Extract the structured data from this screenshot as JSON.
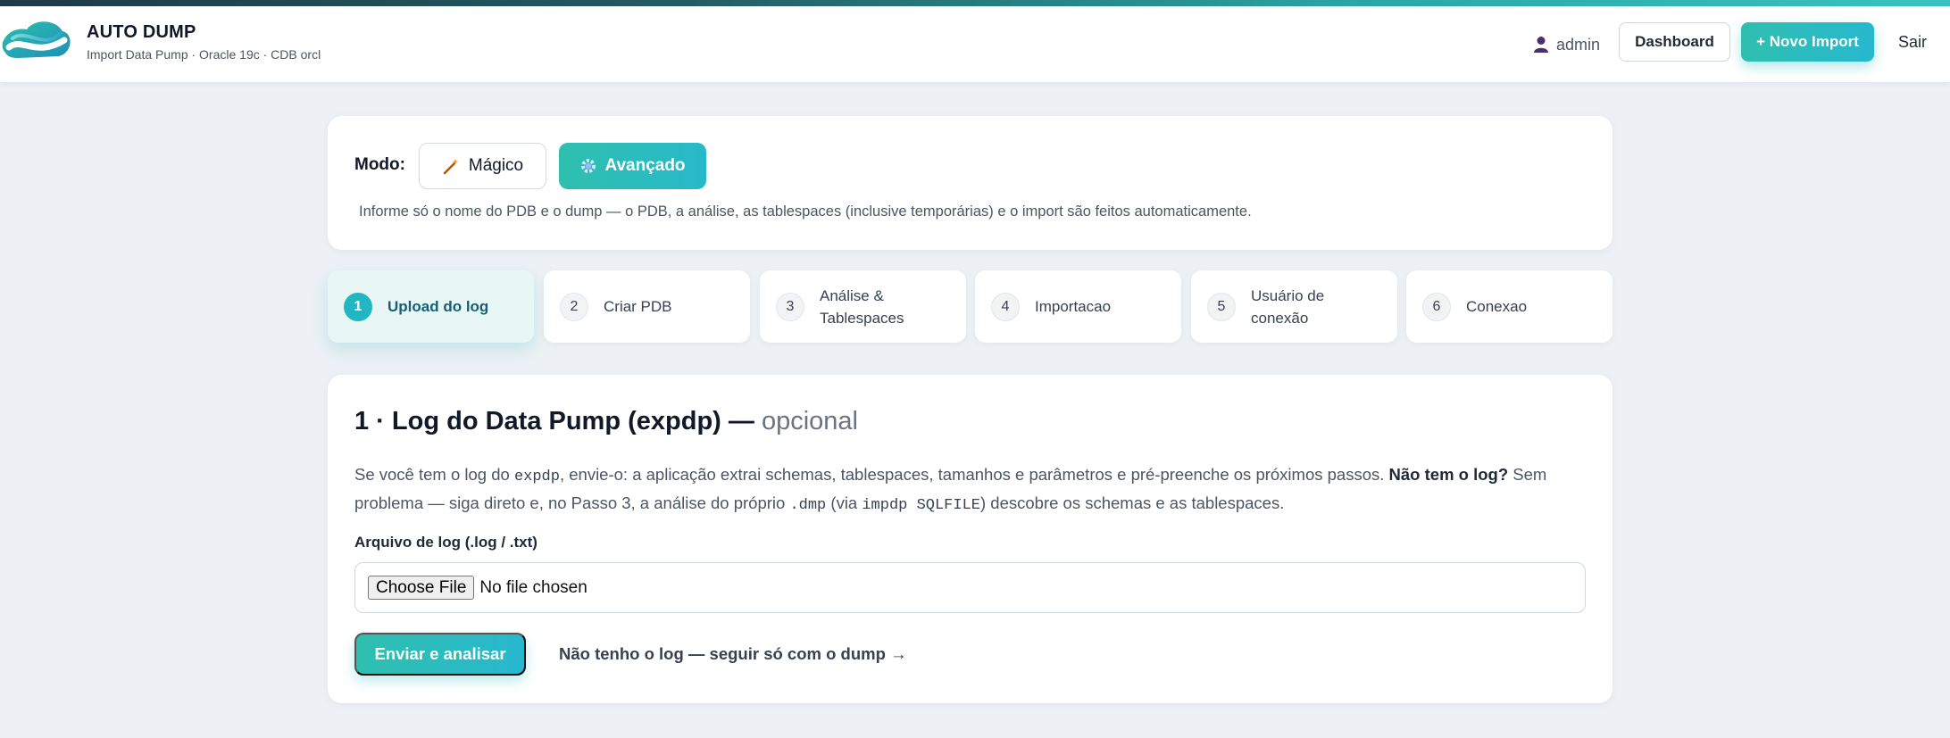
{
  "header": {
    "brand_title": "AUTO DUMP",
    "brand_subtitle": "Import Data Pump · Oracle 19c · CDB orcl",
    "user_name": "admin",
    "dashboard_label": "Dashboard",
    "new_import_label": "+ Novo Import",
    "logout_label": "Sair"
  },
  "mode": {
    "label": "Modo:",
    "magic_label": "Mágico",
    "advanced_label": "Avançado",
    "description": "Informe só o nome do PDB e o dump — o PDB, a análise, as tablespaces (inclusive temporárias) e o import são feitos automaticamente."
  },
  "steps": [
    {
      "num": "1",
      "label": "Upload do log",
      "active": true
    },
    {
      "num": "2",
      "label": "Criar PDB"
    },
    {
      "num": "3",
      "label": "Análise &\nTablespaces"
    },
    {
      "num": "4",
      "label": "Importacao"
    },
    {
      "num": "5",
      "label": "Usuário de\nconexão"
    },
    {
      "num": "6",
      "label": "Conexao"
    }
  ],
  "section": {
    "title": "1 · Log do Data Pump (expdp) —",
    "title_optional": "opcional",
    "desc_1": "Se você tem o log do ",
    "desc_code_1": "expdp",
    "desc_2": ", envie-o: a aplicação extrai schemas, tablespaces, tamanhos e parâmetros e pré-preenche os próximos passos. ",
    "desc_bold": "Não tem o log?",
    "desc_3": " Sem problema — siga direto e, no Passo 3, a análise do próprio ",
    "desc_code_2": ".dmp",
    "desc_4": " (via ",
    "desc_code_3": "impdp SQLFILE",
    "desc_5": ") descobre os schemas e as tablespaces.",
    "file_label": "Arquivo de log (.log / .txt)",
    "file_button": "Choose File",
    "file_status": "No file chosen",
    "submit_label": "Enviar e analisar",
    "skip_label": "Não tenho o log — seguir só com o dump →"
  },
  "colors": {
    "accent": "#27b8c0",
    "accent_gradient_start": "#2fbfae",
    "accent_gradient_end": "#27b8cf",
    "active_step_bg": "#e8f7f6",
    "page_bg": "#edf1f5"
  },
  "icons": {
    "user": "user-icon",
    "magic": "magic-wand-icon",
    "advanced": "gear-icon",
    "logo": "cloud-logo-icon"
  }
}
